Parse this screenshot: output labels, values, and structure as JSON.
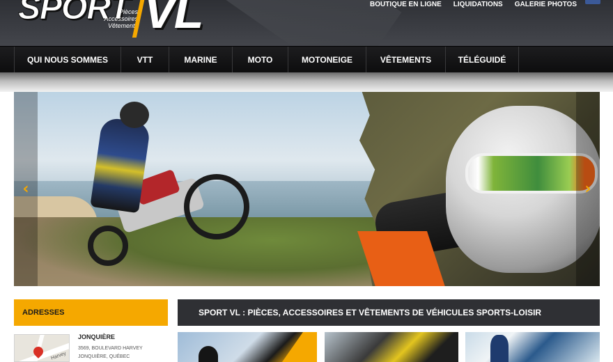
{
  "header": {
    "logo": {
      "word1": "SPORT",
      "word2": "VL",
      "tagline": [
        "Pièces",
        "Accessoires",
        "Vêtements"
      ]
    },
    "top_links": [
      "BOUTIQUE EN LIGNE",
      "LIQUIDATIONS",
      "GALERIE PHOTOS"
    ],
    "social_icon": "facebook-icon"
  },
  "nav": {
    "items": [
      "QUI NOUS SOMMES",
      "VTT",
      "MARINE",
      "MOTO",
      "MOTONEIGE",
      "VÊTEMENTS",
      "TÉLÉGUIDÉ"
    ]
  },
  "slider": {
    "prev_icon": "chevron-left-icon",
    "next_icon": "chevron-right-icon",
    "prev_glyph": "‹",
    "next_glyph": "›"
  },
  "addresses": {
    "heading": "ADRESSES",
    "map_street": "Harvey",
    "city": "JONQUIÈRE",
    "line1": "3569, BOULEVARD HARVEY",
    "line2": "JONQUIÈRE, QUÉBEC"
  },
  "main": {
    "title": "SPORT VL : PIÈCES, ACCESSOIRES ET VÊTEMENTS DE VÉHICULES SPORTS-LOISIR"
  },
  "colors": {
    "accent": "#f5a800",
    "nav_bg": "#151516",
    "title_bar": "#2f3034"
  }
}
